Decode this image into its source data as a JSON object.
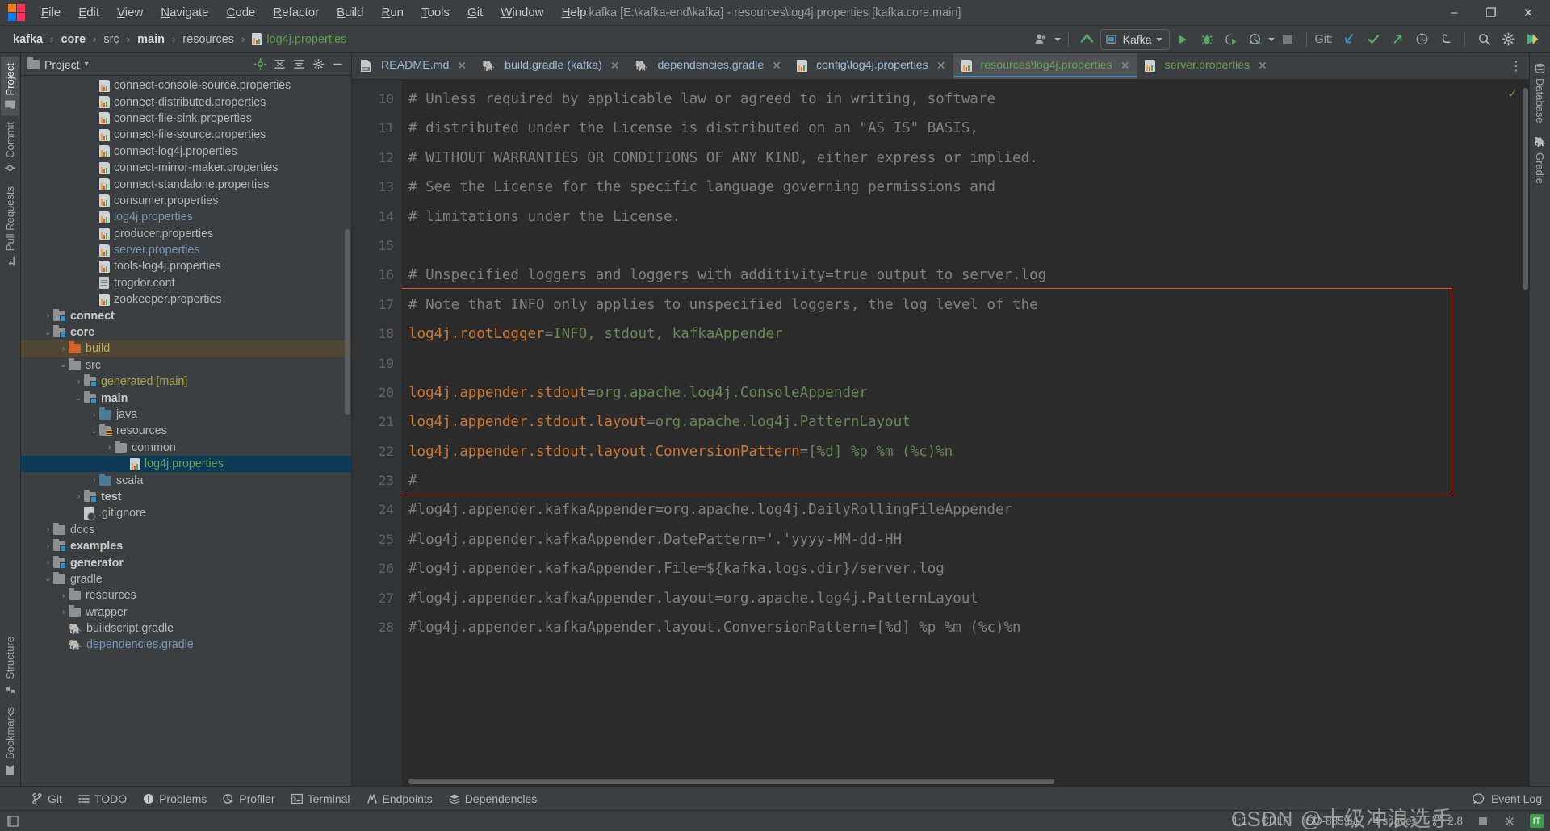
{
  "window": {
    "title": "kafka [E:\\kafka-end\\kafka] - resources\\log4j.properties [kafka.core.main]",
    "minimize": "–",
    "maximize": "❐",
    "close": "✕"
  },
  "menubar": {
    "items": [
      {
        "label": "File"
      },
      {
        "label": "Edit"
      },
      {
        "label": "View"
      },
      {
        "label": "Navigate"
      },
      {
        "label": "Code"
      },
      {
        "label": "Refactor"
      },
      {
        "label": "Build"
      },
      {
        "label": "Run"
      },
      {
        "label": "Tools"
      },
      {
        "label": "Git"
      },
      {
        "label": "Window"
      },
      {
        "label": "Help"
      }
    ]
  },
  "breadcrumb": {
    "items": [
      {
        "label": "kafka",
        "style": "bold"
      },
      {
        "label": "core",
        "style": "bold"
      },
      {
        "label": "src",
        "style": "normal"
      },
      {
        "label": "main",
        "style": "bold"
      },
      {
        "label": "resources",
        "style": "normal"
      },
      {
        "label": "log4j.properties",
        "style": "green-file"
      }
    ],
    "separator": "›"
  },
  "toolbar": {
    "run_config": "Kafka",
    "git_label": "Git:",
    "icons": [
      "user-avatar-icon",
      "updates-arrow-icon",
      "run-config-selector",
      "run-icon",
      "debug-icon",
      "run-with-coverage-icon",
      "profile-icon",
      "stop-icon",
      "git-update-icon",
      "git-commit-icon",
      "git-push-icon",
      "history-icon",
      "undo-icon",
      "search-everywhere-icon",
      "settings-icon",
      "ide-assistant-icon"
    ]
  },
  "left_stripe": {
    "top": [
      {
        "label": "Project",
        "icon": "project-folder-icon",
        "active": true
      },
      {
        "label": "Commit",
        "icon": "commit-icon",
        "active": false
      },
      {
        "label": "Pull Requests",
        "icon": "pull-request-icon",
        "active": false
      }
    ],
    "bottom": [
      {
        "label": "Structure",
        "icon": "structure-icon"
      },
      {
        "label": "Bookmarks",
        "icon": "bookmark-icon"
      }
    ]
  },
  "right_stripe": {
    "top": [
      {
        "label": "Database",
        "icon": "database-icon"
      },
      {
        "label": "Gradle",
        "icon": "gradle-elephant-icon"
      }
    ]
  },
  "project_panel": {
    "title": "Project",
    "title_caret": "▾",
    "tools": [
      "locate-icon",
      "expand-all-icon",
      "collapse-all-icon",
      "settings-icon",
      "hide-icon"
    ],
    "tree": [
      {
        "indent": 4,
        "arrow": "",
        "icon": "properties-file-icon",
        "label": "connect-console-source.properties",
        "style": "plain"
      },
      {
        "indent": 4,
        "arrow": "",
        "icon": "properties-file-icon",
        "label": "connect-distributed.properties",
        "style": "plain"
      },
      {
        "indent": 4,
        "arrow": "",
        "icon": "properties-file-icon",
        "label": "connect-file-sink.properties",
        "style": "plain"
      },
      {
        "indent": 4,
        "arrow": "",
        "icon": "properties-file-icon",
        "label": "connect-file-source.properties",
        "style": "plain"
      },
      {
        "indent": 4,
        "arrow": "",
        "icon": "properties-file-icon",
        "label": "connect-log4j.properties",
        "style": "plain"
      },
      {
        "indent": 4,
        "arrow": "",
        "icon": "properties-file-icon",
        "label": "connect-mirror-maker.properties",
        "style": "plain"
      },
      {
        "indent": 4,
        "arrow": "",
        "icon": "properties-file-icon",
        "label": "connect-standalone.properties",
        "style": "plain"
      },
      {
        "indent": 4,
        "arrow": "",
        "icon": "properties-file-icon",
        "label": "consumer.properties",
        "style": "plain"
      },
      {
        "indent": 4,
        "arrow": "",
        "icon": "properties-file-icon",
        "label": "log4j.properties",
        "style": "blue"
      },
      {
        "indent": 4,
        "arrow": "",
        "icon": "properties-file-icon",
        "label": "producer.properties",
        "style": "plain"
      },
      {
        "indent": 4,
        "arrow": "",
        "icon": "properties-file-icon",
        "label": "server.properties",
        "style": "blue"
      },
      {
        "indent": 4,
        "arrow": "",
        "icon": "properties-file-icon",
        "label": "tools-log4j.properties",
        "style": "plain"
      },
      {
        "indent": 4,
        "arrow": "",
        "icon": "conf-file-icon",
        "label": "trogdor.conf",
        "style": "plain"
      },
      {
        "indent": 4,
        "arrow": "",
        "icon": "properties-file-icon",
        "label": "zookeeper.properties",
        "style": "plain"
      },
      {
        "indent": 1,
        "arrow": "›",
        "icon": "module-folder-icon",
        "label": "connect",
        "style": "bold"
      },
      {
        "indent": 1,
        "arrow": "⌄",
        "icon": "module-folder-icon",
        "label": "core",
        "style": "bold"
      },
      {
        "indent": 2,
        "arrow": "›",
        "icon": "build-folder-icon",
        "label": "build",
        "style": "build",
        "row": "build"
      },
      {
        "indent": 2,
        "arrow": "⌄",
        "icon": "plain-folder-icon",
        "label": "src",
        "style": "plain"
      },
      {
        "indent": 3,
        "arrow": "›",
        "icon": "module-folder-icon",
        "label": "generated [main]",
        "style": "olive"
      },
      {
        "indent": 3,
        "arrow": "⌄",
        "icon": "module-folder-icon",
        "label": "main",
        "style": "bold"
      },
      {
        "indent": 4,
        "arrow": "›",
        "icon": "source-folder-icon",
        "label": "java",
        "style": "plain"
      },
      {
        "indent": 4,
        "arrow": "⌄",
        "icon": "resources-folder-icon",
        "label": "resources",
        "style": "plain"
      },
      {
        "indent": 5,
        "arrow": "›",
        "icon": "plain-folder-icon",
        "label": "common",
        "style": "plain"
      },
      {
        "indent": 6,
        "arrow": "",
        "icon": "properties-file-icon",
        "label": "log4j.properties",
        "style": "green",
        "row": "selected"
      },
      {
        "indent": 4,
        "arrow": "›",
        "icon": "source-folder-icon",
        "label": "scala",
        "style": "plain"
      },
      {
        "indent": 3,
        "arrow": "›",
        "icon": "module-folder-icon",
        "label": "test",
        "style": "bold"
      },
      {
        "indent": 3,
        "arrow": "",
        "icon": "gitignore-file-icon",
        "label": ".gitignore",
        "style": "plain"
      },
      {
        "indent": 1,
        "arrow": "›",
        "icon": "plain-folder-icon",
        "label": "docs",
        "style": "plain"
      },
      {
        "indent": 1,
        "arrow": "›",
        "icon": "module-folder-icon",
        "label": "examples",
        "style": "bold"
      },
      {
        "indent": 1,
        "arrow": "›",
        "icon": "module-folder-icon",
        "label": "generator",
        "style": "bold"
      },
      {
        "indent": 1,
        "arrow": "⌄",
        "icon": "plain-folder-icon",
        "label": "gradle",
        "style": "plain"
      },
      {
        "indent": 2,
        "arrow": "›",
        "icon": "plain-folder-icon",
        "label": "resources",
        "style": "plain"
      },
      {
        "indent": 2,
        "arrow": "›",
        "icon": "plain-folder-icon",
        "label": "wrapper",
        "style": "plain"
      },
      {
        "indent": 2,
        "arrow": "",
        "icon": "gradle-file-icon",
        "label": "buildscript.gradle",
        "style": "plain"
      },
      {
        "indent": 2,
        "arrow": "",
        "icon": "gradle-file-icon",
        "label": "dependencies.gradle",
        "style": "blue"
      }
    ]
  },
  "editor_tabs": {
    "close_glyph": "✕",
    "items": [
      {
        "label": "README.md",
        "icon": "markdown-file-icon",
        "active": false,
        "color": "blue"
      },
      {
        "label": "build.gradle (kafka)",
        "icon": "gradle-file-icon",
        "active": false,
        "color": "blue"
      },
      {
        "label": "dependencies.gradle",
        "icon": "gradle-file-icon",
        "active": false,
        "color": "blue"
      },
      {
        "label": "config\\log4j.properties",
        "icon": "properties-file-icon",
        "active": false,
        "color": "blue"
      },
      {
        "label": "resources\\log4j.properties",
        "icon": "properties-file-icon",
        "active": true,
        "color": "green"
      },
      {
        "label": "server.properties",
        "icon": "properties-file-icon",
        "active": false,
        "color": "green"
      }
    ],
    "overflow_glyph": "⋮"
  },
  "editor": {
    "inspection_glyph": "✓",
    "first_line_number": 10,
    "lines": [
      {
        "n": 10,
        "segments": [
          {
            "t": "# Unless required by applicable law or agreed to in writing, software",
            "c": "com"
          }
        ]
      },
      {
        "n": 11,
        "segments": [
          {
            "t": "# distributed under the License is distributed on an \"AS IS\" BASIS,",
            "c": "com"
          }
        ]
      },
      {
        "n": 12,
        "segments": [
          {
            "t": "# WITHOUT WARRANTIES OR CONDITIONS OF ANY KIND, either express or implied.",
            "c": "com"
          }
        ]
      },
      {
        "n": 13,
        "segments": [
          {
            "t": "# See the License for the specific language governing permissions and",
            "c": "com"
          }
        ]
      },
      {
        "n": 14,
        "segments": [
          {
            "t": "# limitations under the License.",
            "c": "com"
          }
        ]
      },
      {
        "n": 15,
        "segments": [
          {
            "t": "",
            "c": "com"
          }
        ]
      },
      {
        "n": 16,
        "segments": [
          {
            "t": "# Unspecified loggers and loggers with additivity=true output to server.log",
            "c": "com"
          }
        ]
      },
      {
        "n": 17,
        "segments": [
          {
            "t": "# Note that INFO only applies to unspecified loggers, the log level of the",
            "c": "com"
          }
        ]
      },
      {
        "n": 18,
        "segments": [
          {
            "t": "log4j.rootLogger",
            "c": "key"
          },
          {
            "t": "=",
            "c": "dim"
          },
          {
            "t": "INFO, stdout, kafkaAppender",
            "c": "val"
          }
        ]
      },
      {
        "n": 19,
        "segments": [
          {
            "t": "",
            "c": "com"
          }
        ]
      },
      {
        "n": 20,
        "segments": [
          {
            "t": "log4j.appender.stdout",
            "c": "key"
          },
          {
            "t": "=",
            "c": "dim"
          },
          {
            "t": "org.apache.log4j.ConsoleAppender",
            "c": "val"
          }
        ]
      },
      {
        "n": 21,
        "segments": [
          {
            "t": "log4j.appender.stdout.layout",
            "c": "key"
          },
          {
            "t": "=",
            "c": "dim"
          },
          {
            "t": "org.apache.log4j.PatternLayout",
            "c": "val"
          }
        ]
      },
      {
        "n": 22,
        "segments": [
          {
            "t": "log4j.appender.stdout.layout.ConversionPattern",
            "c": "key"
          },
          {
            "t": "=",
            "c": "dim"
          },
          {
            "t": "[%d] %p %m (%c)%n",
            "c": "val"
          }
        ]
      },
      {
        "n": 23,
        "segments": [
          {
            "t": "#",
            "c": "com"
          }
        ]
      },
      {
        "n": 24,
        "segments": [
          {
            "t": "#log4j.appender.kafkaAppender=org.apache.log4j.DailyRollingFileAppender",
            "c": "com"
          }
        ]
      },
      {
        "n": 25,
        "segments": [
          {
            "t": "#log4j.appender.kafkaAppender.DatePattern='.'yyyy-MM-dd-HH",
            "c": "com"
          }
        ]
      },
      {
        "n": 26,
        "segments": [
          {
            "t": "#log4j.appender.kafkaAppender.File=${kafka.logs.dir}/server.log",
            "c": "com"
          }
        ]
      },
      {
        "n": 27,
        "segments": [
          {
            "t": "#log4j.appender.kafkaAppender.layout=org.apache.log4j.PatternLayout",
            "c": "com"
          }
        ]
      },
      {
        "n": 28,
        "segments": [
          {
            "t": "#log4j.appender.kafkaAppender.layout.ConversionPattern=[%d] %p %m (%c)%n",
            "c": "com"
          }
        ]
      }
    ],
    "highlight": {
      "from_line": 17,
      "to_line": 23,
      "color": "#e8493a"
    }
  },
  "bottom_bar": {
    "items": [
      {
        "label": "Git",
        "icon": "git-branch-icon"
      },
      {
        "label": "TODO",
        "icon": "todo-list-icon"
      },
      {
        "label": "Problems",
        "icon": "problems-icon"
      },
      {
        "label": "Profiler",
        "icon": "profiler-icon"
      },
      {
        "label": "Terminal",
        "icon": "terminal-icon"
      },
      {
        "label": "Endpoints",
        "icon": "endpoints-icon"
      },
      {
        "label": "Dependencies",
        "icon": "dependencies-icon"
      }
    ],
    "event_log": "Event Log",
    "event_log_icon": "event-log-icon"
  },
  "status_bar": {
    "left_icon": "toggle-toolwindows-icon",
    "caret_position": "1:1",
    "line_separator": "CRLF",
    "encoding": "ISO-8859-1",
    "indent": "4 spaces",
    "branch_icon": "git-branch-icon",
    "branch": "2.8",
    "stop_icon": "stop-daemon-icon",
    "settings_icon": "settings-icon",
    "license_badge": "IT",
    "watermark": "CSDN @十级冲浪选手"
  },
  "colors": {
    "accent_blue": "#4a88c7",
    "comment_gray": "#808080",
    "key_orange": "#cc7832",
    "value_green": "#6a8759",
    "highlight_red": "#e8493a",
    "selection_blue": "#0d3a58",
    "panel_bg": "#3c3f41",
    "editor_bg": "#2b2b2b"
  }
}
